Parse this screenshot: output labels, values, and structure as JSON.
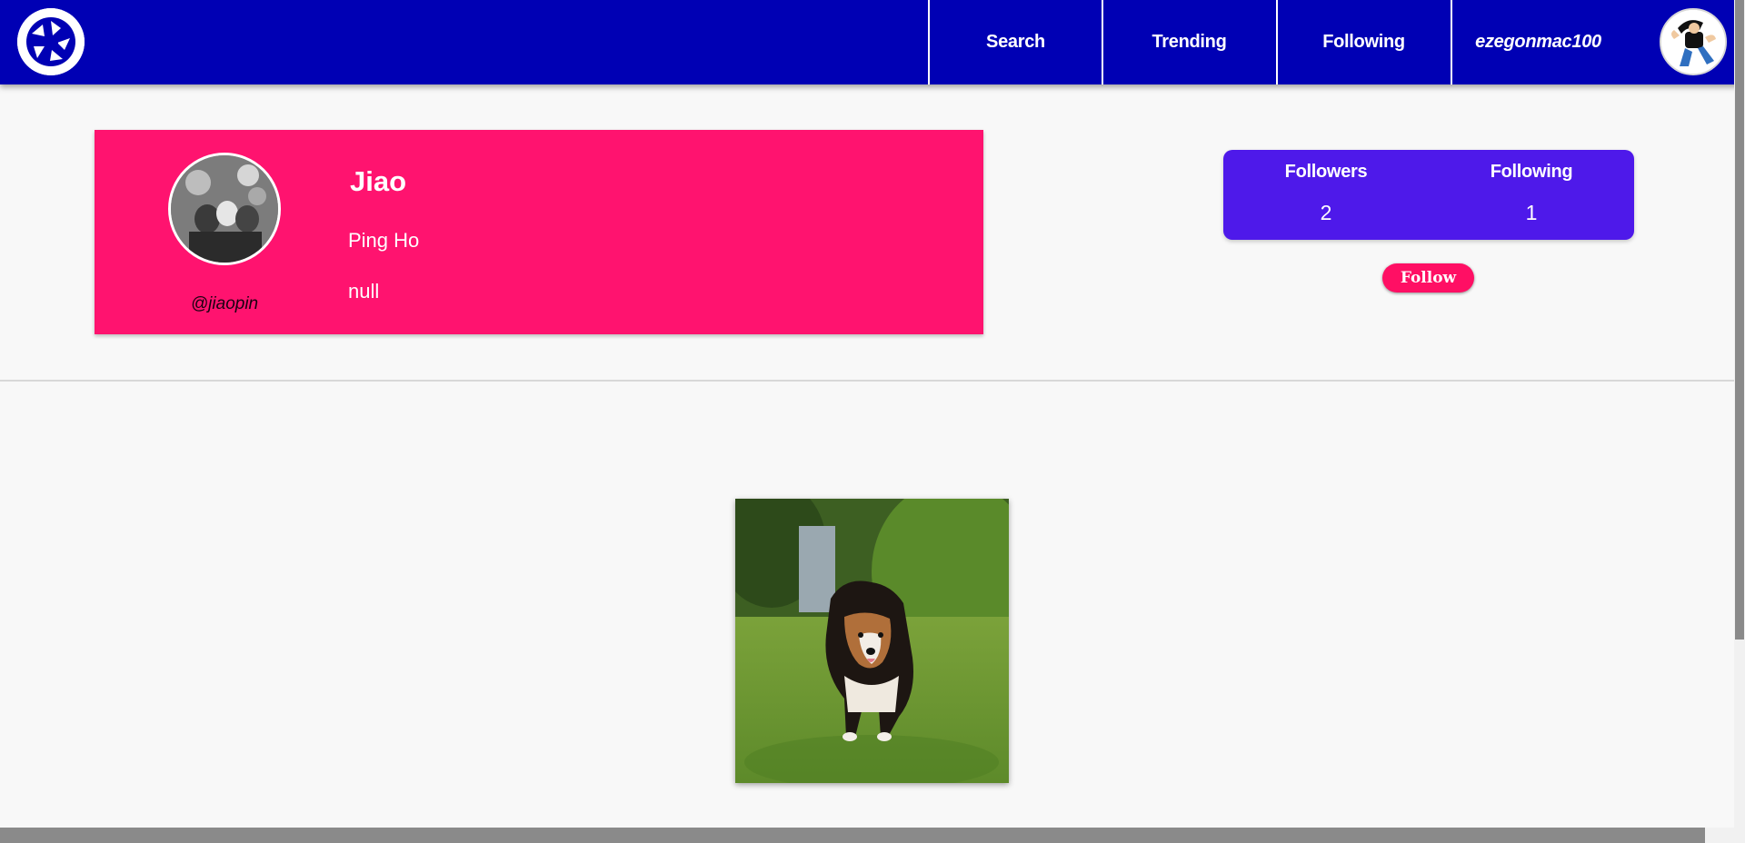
{
  "navbar": {
    "logo_icon": "camera-shutter-icon",
    "items": [
      {
        "label": "Search"
      },
      {
        "label": "Trending"
      },
      {
        "label": "Following"
      }
    ],
    "username": "ezegonmac100",
    "avatar_icon": "user-avatar-cartoon",
    "bg_color": "#0000b4"
  },
  "profile": {
    "display_name": "Jiao",
    "full_name": "Ping Ho",
    "bio": "null",
    "handle": "@jiaopin",
    "card_color": "#ff136f"
  },
  "stats": {
    "followers_label": "Followers",
    "followers_count": "2",
    "following_label": "Following",
    "following_count": "1",
    "box_color": "#4e19ea"
  },
  "actions": {
    "follow_label": "Follow"
  },
  "posts": [
    {
      "image_icon": "dog-running-photo"
    }
  ]
}
